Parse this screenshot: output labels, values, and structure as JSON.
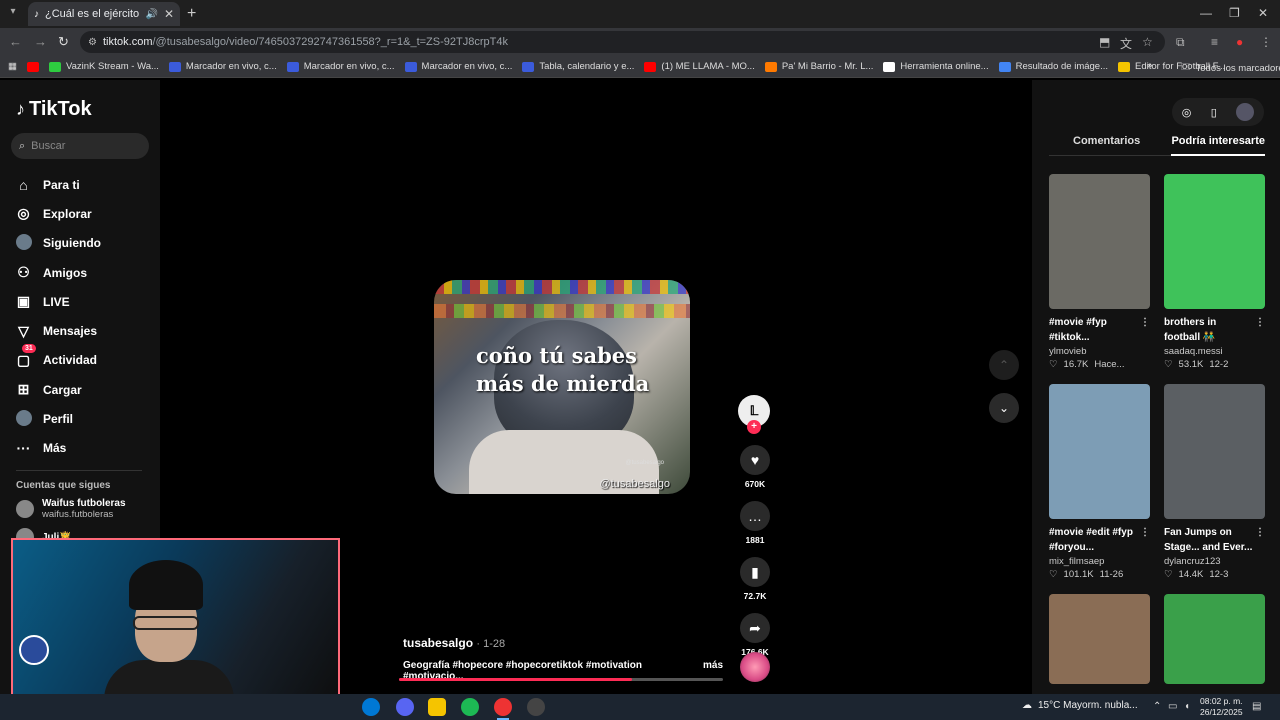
{
  "browser": {
    "tab_title": "¿Cuál es el ejército más pe",
    "url_host": "tiktok.com",
    "url_rest": "/@tusabesalgo/video/7465037292747361558?_r=1&_t=ZS-92TJ8crpT4k",
    "bookmarks": [
      {
        "label": "",
        "color": "#ff0000"
      },
      {
        "label": "VazinK Stream - Wa...",
        "color": "#2ecc40"
      },
      {
        "label": "Marcador en vivo, c...",
        "color": "#3b5bdb"
      },
      {
        "label": "Marcador en vivo, c...",
        "color": "#3b5bdb"
      },
      {
        "label": "Marcador en vivo, c...",
        "color": "#3b5bdb"
      },
      {
        "label": "Tabla, calendario y e...",
        "color": "#3b5bdb"
      },
      {
        "label": "(1) ME LLAMA - MO...",
        "color": "#ff0000"
      },
      {
        "label": "Pa' Mi Barrio - Mr. L...",
        "color": "#ff7a00"
      },
      {
        "label": "Herramienta online...",
        "color": "#ffffff"
      },
      {
        "label": "Resultado de imáge...",
        "color": "#4285f4"
      },
      {
        "label": "Editor for Football F...",
        "color": "#f5c400"
      }
    ],
    "all_bookmarks": "Todos los marcadores"
  },
  "sidebar": {
    "logo": "TikTok",
    "search_placeholder": "Buscar",
    "items": [
      {
        "label": "Para ti",
        "icon": "home-icon"
      },
      {
        "label": "Explorar",
        "icon": "compass-icon"
      },
      {
        "label": "Siguiendo",
        "icon": "avatar"
      },
      {
        "label": "Amigos",
        "icon": "friends-icon"
      },
      {
        "label": "LIVE",
        "icon": "live-icon"
      },
      {
        "label": "Mensajes",
        "icon": "messages-icon"
      },
      {
        "label": "Actividad",
        "icon": "activity-icon",
        "badge": "31"
      },
      {
        "label": "Cargar",
        "icon": "upload-icon"
      },
      {
        "label": "Perfil",
        "icon": "avatar"
      },
      {
        "label": "Más",
        "icon": "more-icon"
      }
    ],
    "following_title": "Cuentas que sigues",
    "following": [
      {
        "name": "Waifus futboleras",
        "handle": "waifus.futboleras"
      },
      {
        "name": "Juli🤴",
        "handle": ""
      }
    ]
  },
  "video": {
    "overlay_text": "coño tú sabes más de mierda",
    "watermark": "@tusabesalgo",
    "watermark_small": "@tusabesalgo",
    "author": "tusabesalgo",
    "date": "1-28",
    "description": "Geografía #hopecore #hopecoretiktok #motivation #motivacio...",
    "more": "más",
    "progress": 0.72,
    "likes": "670K",
    "comments": "1881",
    "saves": "72.7K",
    "shares": "176.6K"
  },
  "right_panel": {
    "tab_comments": "Comentarios",
    "tab_suggested": "Podría interesarte",
    "cards": [
      {
        "caption": "#movie #fyp #tiktok...",
        "handle": "ylmovieb",
        "likes": "16.7K",
        "date": "Hace...",
        "bg": "#6b6a64"
      },
      {
        "caption": "brothers in football 👬",
        "handle": "saadaq.messi",
        "likes": "53.1K",
        "date": "12-2",
        "bg": "#3fc25a"
      },
      {
        "caption": "#movie #edit #fyp #foryou...",
        "handle": "mix_filmsaep",
        "likes": "101.1K",
        "date": "11-26",
        "bg": "#7d9db5"
      },
      {
        "caption": "Fan Jumps on Stage... and Ever...",
        "handle": "dylancruz123",
        "likes": "14.4K",
        "date": "12-3",
        "bg": "#5b5f63"
      },
      {
        "caption": "",
        "handle": "",
        "likes": "",
        "date": "",
        "bg": "#8a6d55"
      },
      {
        "caption": "",
        "handle": "",
        "likes": "",
        "date": "",
        "bg": "#3aa04a"
      }
    ]
  },
  "taskbar": {
    "weather": "15°C  Mayorm. nubla...",
    "time": "08:02 p. m.",
    "date": "26/12/2025"
  }
}
